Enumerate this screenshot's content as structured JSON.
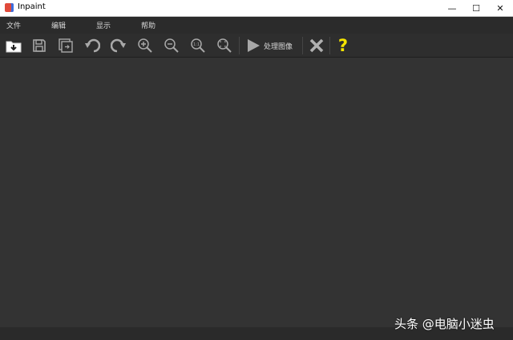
{
  "window": {
    "title": "Inpaint",
    "minimize_glyph": "—",
    "maximize_glyph": "☐",
    "close_glyph": "✕"
  },
  "menu": {
    "items": [
      {
        "label": "文件"
      },
      {
        "label": "编辑"
      },
      {
        "label": "显示"
      },
      {
        "label": "帮助"
      }
    ]
  },
  "toolbar": {
    "buttons": [
      {
        "icon": "open-folder-icon"
      },
      {
        "icon": "save-icon"
      },
      {
        "icon": "save-as-icon"
      },
      {
        "icon": "undo-icon"
      },
      {
        "icon": "redo-icon"
      },
      {
        "icon": "zoom-in-icon"
      },
      {
        "icon": "zoom-out-icon"
      },
      {
        "icon": "zoom-actual-size-icon",
        "text": "1:1"
      },
      {
        "icon": "zoom-fit-icon"
      }
    ],
    "process_label": "处理图像",
    "process_icon": "play-icon",
    "clear_icon": "close-x-icon",
    "help_glyph": "?",
    "help_color": "#f5e400"
  },
  "watermark": {
    "text": "头条 @电脑小迷虫"
  },
  "colors": {
    "menubar_bg": "#2b2b2b",
    "toolbar_bg": "#2e2e2e",
    "canvas_bg": "#333333",
    "icon": "#a8a8a8"
  }
}
